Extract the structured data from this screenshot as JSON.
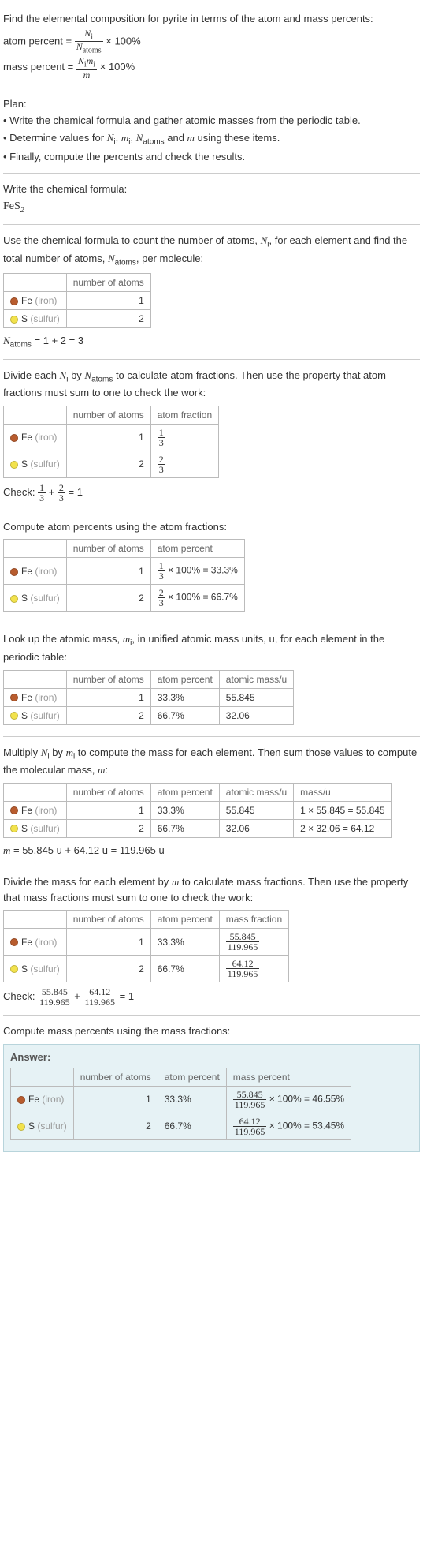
{
  "intro": {
    "line1": "Find the elemental composition for pyrite in terms of the atom and mass percents:",
    "eq1_lhs": "atom percent =",
    "eq1_frac_n": "N",
    "eq1_frac_n_sub": "i",
    "eq1_frac_d": "N",
    "eq1_frac_d_sub": "atoms",
    "eq1_rhs": "× 100%",
    "eq2_lhs": "mass percent =",
    "eq2_frac_n": "N",
    "eq2_frac_n_sub": "i",
    "eq2_frac_n2": "m",
    "eq2_frac_n2_sub": "i",
    "eq2_frac_d": "m",
    "eq2_rhs": "× 100%"
  },
  "plan": {
    "h": "Plan:",
    "b1": "• Write the chemical formula and gather atomic masses from the periodic table.",
    "b2_a": "• Determine values for ",
    "b2_b": " using these items.",
    "b3": "• Finally, compute the percents and check the results."
  },
  "formula": {
    "h": "Write the chemical formula:",
    "fe": "FeS",
    "sub": "2"
  },
  "count": {
    "h1": "Use the chemical formula to count the number of atoms, ",
    "h2": ", for each element and find the total number of atoms, ",
    "h3": ", per molecule:",
    "col_atoms": "number of atoms",
    "fe_name": "Fe",
    "fe_paren": "(iron)",
    "fe_n": "1",
    "s_name": "S",
    "s_paren": "(sulfur)",
    "s_n": "2",
    "sum": " = 1 + 2 = 3"
  },
  "atomfrac": {
    "h": "Divide each ",
    "h2": " by ",
    "h3": " to calculate atom fractions. Then use the property that atom fractions must sum to one to check the work:",
    "col_frac": "atom fraction",
    "fe_n": "1",
    "fe_d": "3",
    "s_n": "2",
    "s_d": "3",
    "check": "Check: ",
    "check_eq": " = 1"
  },
  "atompct": {
    "h": "Compute atom percents using the atom fractions:",
    "col": "atom percent",
    "fe": " × 100% = 33.3%",
    "s": " × 100% = 66.7%"
  },
  "mass_lookup": {
    "h": "Look up the atomic mass, ",
    "h2": ", in unified atomic mass units, u, for each element in the periodic table:",
    "col": "atomic mass/u",
    "fe_pct": "33.3%",
    "s_pct": "66.7%",
    "fe_m": "55.845",
    "s_m": "32.06"
  },
  "mass_mult": {
    "h": "Multiply ",
    "h2": " by ",
    "h3": " to compute the mass for each element. Then sum those values to compute the molecular mass, ",
    "h4": ":",
    "col": "mass/u",
    "fe": "1 × 55.845 = 55.845",
    "s": "2 × 32.06 = 64.12",
    "sum": " = 55.845 u + 64.12 u = 119.965 u"
  },
  "massfrac": {
    "h": "Divide the mass for each element by ",
    "h2": " to calculate mass fractions. Then use the property that mass fractions must sum to one to check the work:",
    "col": "mass fraction",
    "fe_n": "55.845",
    "fe_d": "119.965",
    "s_n": "64.12",
    "s_d": "119.965",
    "check": "Check: ",
    "check_eq": " = 1"
  },
  "masspct": {
    "h": "Compute mass percents using the mass fractions:"
  },
  "answer": {
    "h": "Answer:",
    "col": "mass percent",
    "fe": " × 100% = 46.55%",
    "s": " × 100% = 53.45%"
  },
  "sym": {
    "Ni": "N",
    "i": "i",
    "Na": "N",
    "atoms": "atoms",
    "mi": "m",
    "m": "m",
    "plus": " + ",
    "and": " and "
  }
}
